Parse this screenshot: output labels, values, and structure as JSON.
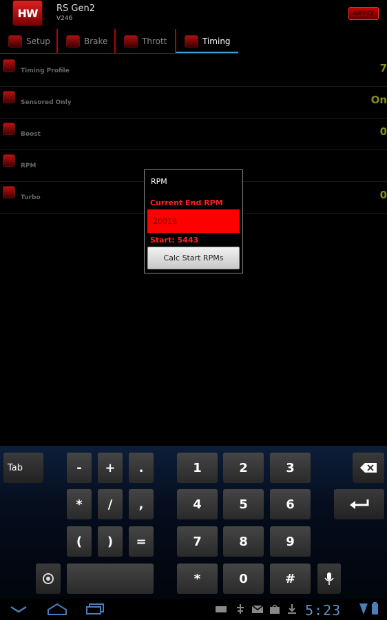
{
  "header": {
    "logo_text": "HW",
    "title": "RS Gen2",
    "version": "V246",
    "apply_label": "APPLY"
  },
  "tabs": [
    {
      "label": "Setup",
      "icon": "setup-icon",
      "active": false
    },
    {
      "label": "Brake",
      "icon": "brake-icon",
      "active": false
    },
    {
      "label": "Thrott",
      "icon": "throttle-icon",
      "active": false
    },
    {
      "label": "Timing",
      "icon": "timing-icon",
      "active": true
    }
  ],
  "settings": [
    {
      "label": "Timing Profile",
      "value": "7"
    },
    {
      "label": "Sensored Only",
      "value": "On"
    },
    {
      "label": "Boost",
      "value": "0"
    },
    {
      "label": "RPM",
      "value": ""
    },
    {
      "label": "Turbo",
      "value": "0"
    }
  ],
  "dialog": {
    "title": "RPM",
    "field_label": "Current End RPM",
    "field_value": "20016",
    "start_text": "Start: 5443",
    "button_label": "Calc Start RPMs"
  },
  "keyboard": {
    "tab_label": "Tab",
    "row1": [
      "-",
      "+",
      ".",
      "1",
      "2",
      "3"
    ],
    "row2": [
      "*",
      "/",
      ",",
      "4",
      "5",
      "6"
    ],
    "row3": [
      "(",
      ")",
      "=",
      "7",
      "8",
      "9"
    ],
    "row4": [
      "*",
      "0",
      "#"
    ]
  },
  "status": {
    "time": "5:23"
  },
  "colors": {
    "accent_tab": "#34a3d9",
    "value_text": "#8a8a1e",
    "dialog_red": "#ff0000"
  }
}
